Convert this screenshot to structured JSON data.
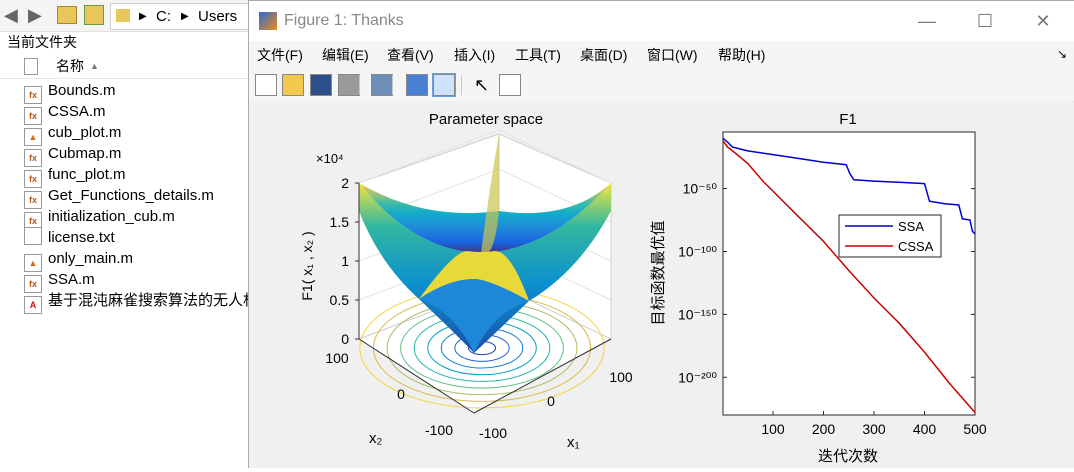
{
  "explorer": {
    "path_drive": "C:",
    "path_folder": "Users",
    "header": "当前文件夹",
    "column_name": "名称",
    "files": [
      {
        "name": "Bounds.m",
        "icon": "matlab-function-icon"
      },
      {
        "name": "CSSA.m",
        "icon": "matlab-function-icon"
      },
      {
        "name": "cub_plot.m",
        "icon": "matlab-script-icon"
      },
      {
        "name": "Cubmap.m",
        "icon": "matlab-function-icon"
      },
      {
        "name": "func_plot.m",
        "icon": "matlab-function-icon"
      },
      {
        "name": "Get_Functions_details.m",
        "icon": "matlab-function-icon"
      },
      {
        "name": "initialization_cub.m",
        "icon": "matlab-function-icon"
      },
      {
        "name": "license.txt",
        "icon": "text-file-icon"
      },
      {
        "name": "only_main.m",
        "icon": "matlab-script-icon"
      },
      {
        "name": "SSA.m",
        "icon": "matlab-function-icon"
      },
      {
        "name": "基于混沌麻雀搜索算法的无人机",
        "icon": "pdf-file-icon"
      }
    ]
  },
  "figure": {
    "title": "Figure 1: Thanks",
    "menus": [
      "文件(F)",
      "编辑(E)",
      "查看(V)",
      "插入(I)",
      "工具(T)",
      "桌面(D)",
      "窗口(W)",
      "帮助(H)"
    ],
    "toolbar_icons": [
      "new-figure-icon",
      "open-icon",
      "save-icon",
      "print-icon",
      "link-plot-icon",
      "colorbar-icon",
      "legend-icon",
      "pointer-icon",
      "property-editor-icon"
    ]
  },
  "chart_data": [
    {
      "type": "surface",
      "title": "Parameter space",
      "zlabel": "F1( x₁ , x₂ )",
      "xlabel": "x₁",
      "ylabel": "x₂",
      "z_exponent": "×10⁴",
      "z_ticks": [
        "0",
        "0.5",
        "1",
        "1.5",
        "2"
      ],
      "x_ticks": [
        "-100",
        "0",
        "100"
      ],
      "y_ticks": [
        "-100",
        "0",
        "100"
      ],
      "xlim": [
        -100,
        100
      ],
      "ylim": [
        -100,
        100
      ],
      "zlim": [
        0,
        20000
      ],
      "colormap": "parula",
      "function": "x1^2 + x2^2",
      "contour_projection": true
    },
    {
      "type": "line",
      "title": "F1",
      "xlabel": "迭代次数",
      "ylabel": "目标函数最优值",
      "yscale": "log",
      "xlim": [
        1,
        500
      ],
      "ylim": [
        1e-230,
        1e-05
      ],
      "x_ticks": [
        "100",
        "200",
        "300",
        "400",
        "500"
      ],
      "y_ticks": [
        "10⁻⁵⁰",
        "10⁻¹⁰⁰",
        "10⁻¹⁵⁰",
        "10⁻²⁰⁰"
      ],
      "legend_position": "center-right",
      "series": [
        {
          "name": "SSA",
          "color": "#0000cc",
          "x": [
            1,
            10,
            20,
            50,
            100,
            150,
            200,
            245,
            252,
            260,
            300,
            350,
            400,
            410,
            440,
            468,
            475,
            490,
            495,
            500
          ],
          "log10_y": [
            -10,
            -13,
            -17,
            -20,
            -23,
            -26,
            -29,
            -31,
            -38,
            -43,
            -44,
            -45,
            -46,
            -60,
            -62,
            -63,
            -74,
            -75,
            -84,
            -86
          ]
        },
        {
          "name": "CSSA",
          "color": "#cc0000",
          "x": [
            1,
            10,
            20,
            50,
            80,
            100,
            150,
            200,
            250,
            300,
            350,
            400,
            450,
            500
          ],
          "log10_y": [
            -12,
            -17,
            -20,
            -30,
            -44,
            -52,
            -72,
            -92,
            -115,
            -137,
            -157,
            -180,
            -205,
            -228
          ]
        }
      ]
    }
  ]
}
